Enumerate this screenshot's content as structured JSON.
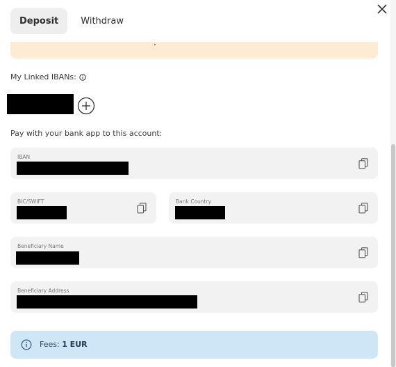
{
  "tabs": [
    {
      "label": "Deposit",
      "active": true
    },
    {
      "label": "Withdraw",
      "active": false
    }
  ],
  "linked_ibans": {
    "label": "My Linked IBANs:"
  },
  "pay_instruction": "Pay with your bank app to this account:",
  "fields": {
    "iban": {
      "label": "IBAN"
    },
    "bic": {
      "label": "BIC/SWIFT"
    },
    "bank_country": {
      "label": "Bank Country"
    },
    "beneficiary_name": {
      "label": "Beneficiary Name"
    },
    "beneficiary_address": {
      "label": "Beneficiary Address"
    }
  },
  "fees": {
    "label": "Fees:",
    "value": "1 EUR"
  },
  "colors": {
    "warning_bg": "#fdebd3",
    "info_bg": "#cfe6f7",
    "field_bg": "#f2f2f2"
  }
}
